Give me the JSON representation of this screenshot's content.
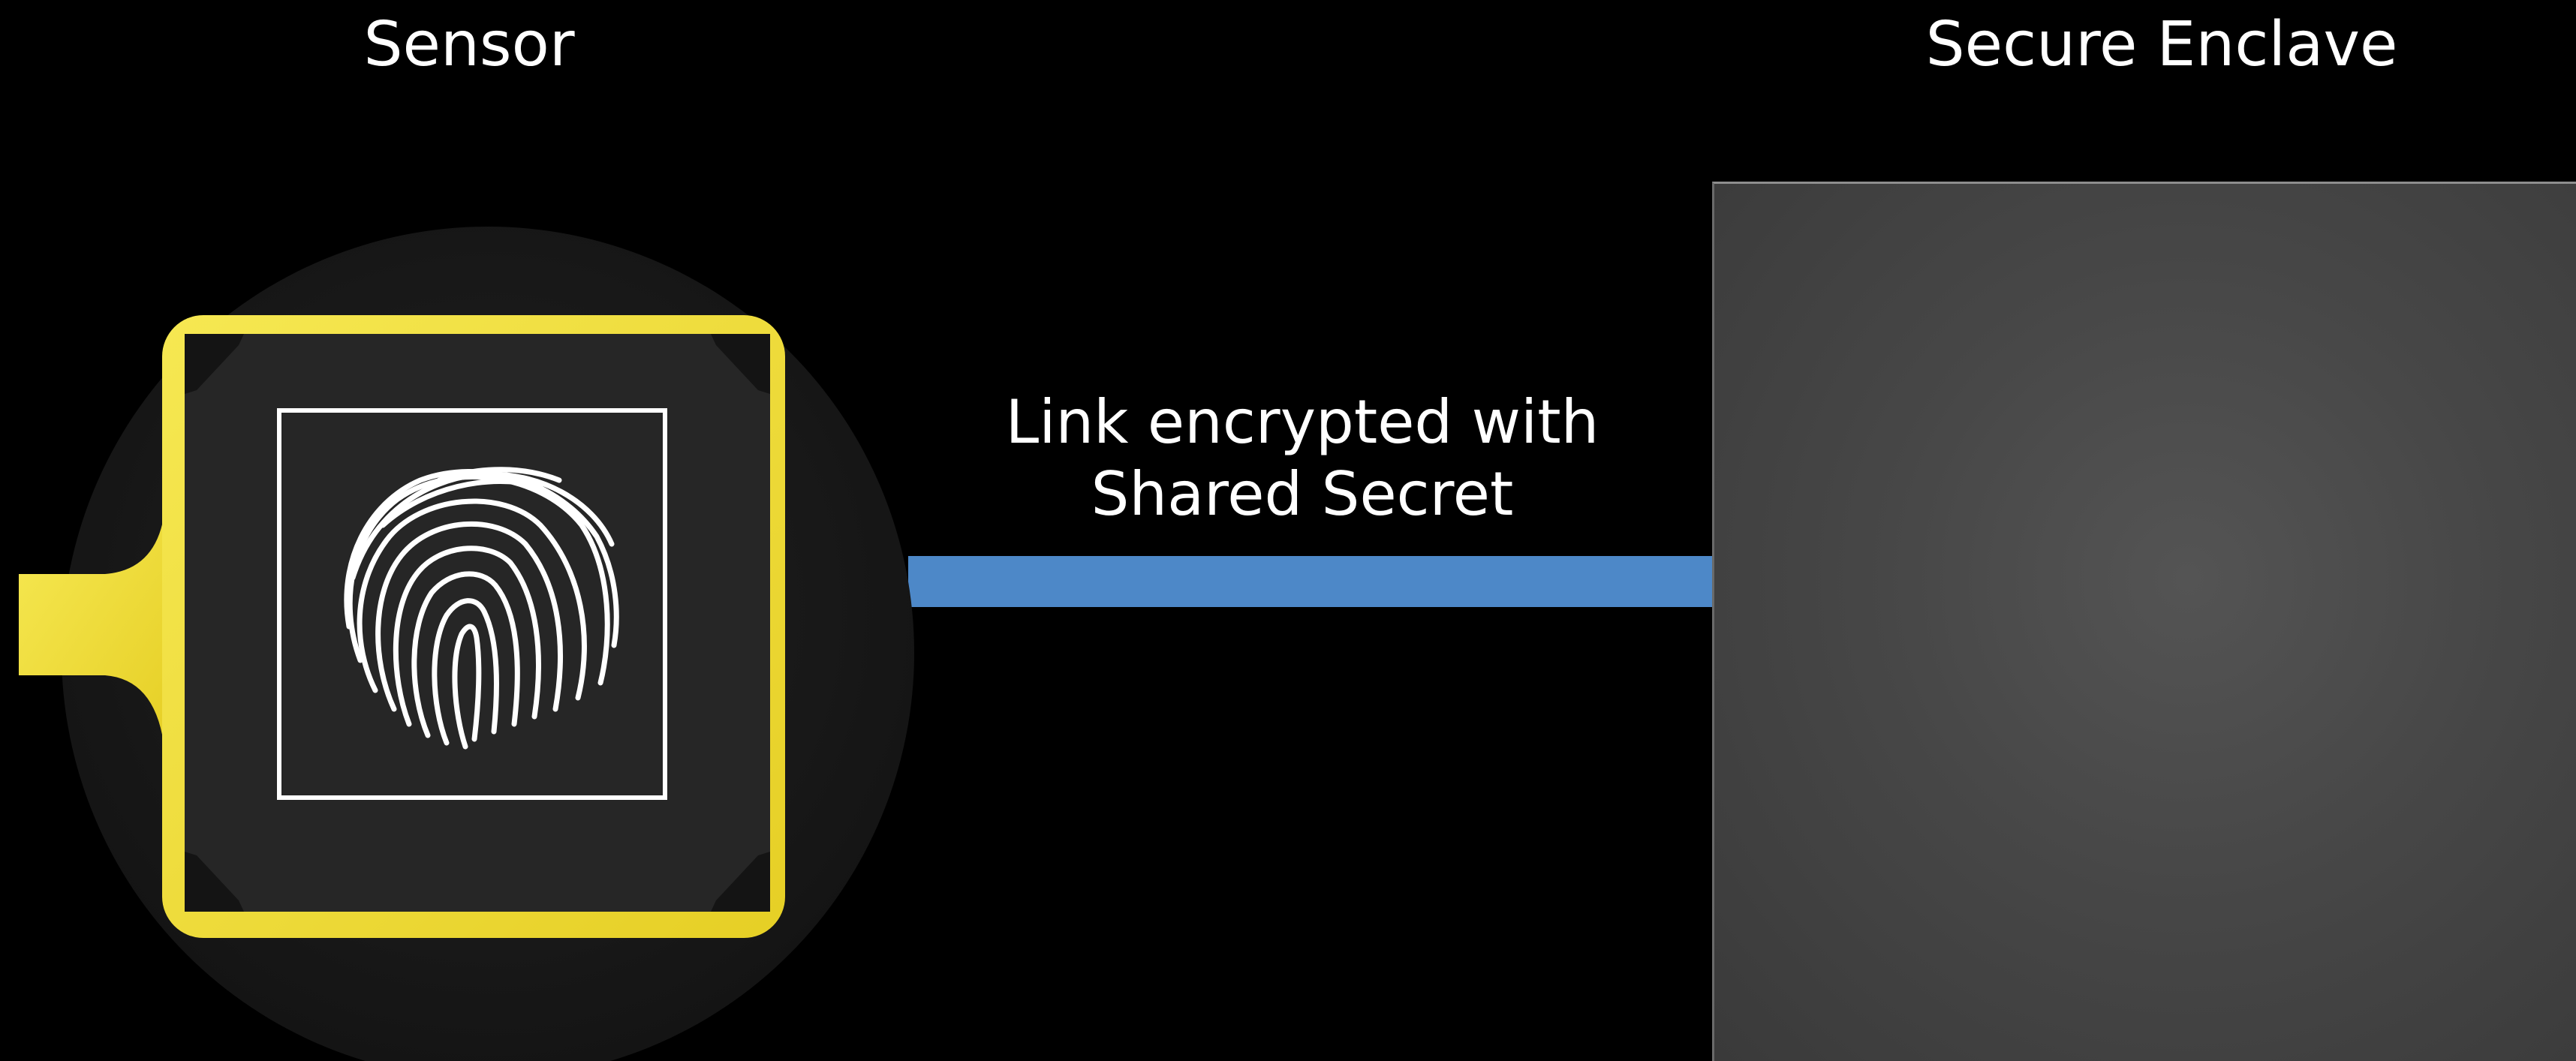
{
  "diagram": {
    "sensor_title": "Sensor",
    "enclave_title": "Secure Enclave",
    "link_label_line1": "Link encrypted with",
    "link_label_line2": "Shared Secret"
  },
  "icons": {
    "fingerprint": "fingerprint-icon"
  },
  "colors": {
    "background": "#000000",
    "link_bar": "#4d88c8",
    "sensor_ring": "#f1e03a",
    "sensor_disc": "#1c1c1c",
    "sensor_chip": "#262626",
    "enclave_fill": "#474747",
    "text": "#ffffff"
  }
}
